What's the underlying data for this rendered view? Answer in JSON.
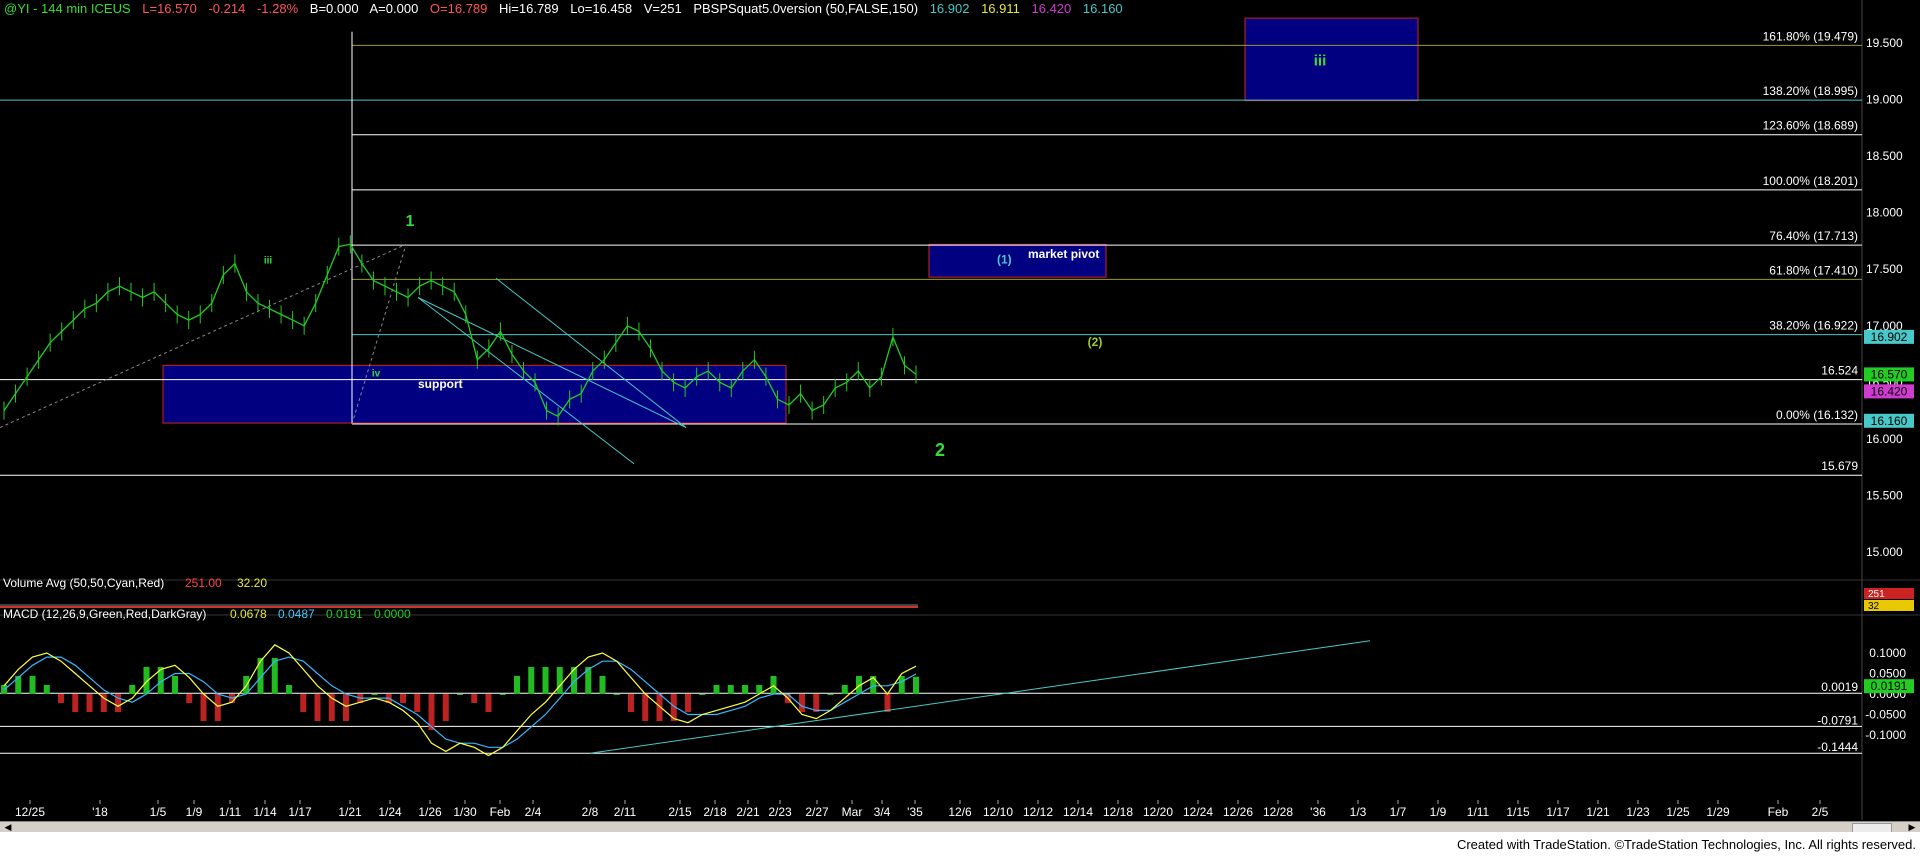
{
  "header": {
    "symbol": "@YI - 144 min  ICEUS",
    "last": "L=16.570",
    "change": "-0.214",
    "pct": "-1.28%",
    "b": "B=0.000",
    "a": "A=0.000",
    "open": "O=16.789",
    "hi": "Hi=16.789",
    "lo": "Lo=16.458",
    "v": "V=251",
    "indicator": "PBSPSquat5.0version (50,FALSE,150)",
    "ind_values": [
      "16.902",
      "16.911",
      "16.420",
      "16.160"
    ]
  },
  "footer": "Created with TradeStation. ©TradeStation Technologies, Inc. All rights reserved.",
  "colors": {
    "price": "#22cc22",
    "fib": "#ffffff",
    "teal": "#48c8c8",
    "olive": "#9a9a3a",
    "box_fill": "#000080",
    "box_border": "#cc2222",
    "wave_label": "#33dd33",
    "macd": "#ffff44",
    "signal": "#3ab6ff"
  },
  "chart_data": [
    {
      "type": "line",
      "name_panel": "price",
      "y_range": [
        14.5,
        19.7
      ],
      "y_ticks": [
        "19.500",
        "19.000",
        "18.500",
        "18.000",
        "17.500",
        "17.000",
        "16.500",
        "16.000",
        "15.500",
        "15.000"
      ],
      "x_labels": [
        "12/25",
        "'18",
        "1/5",
        "1/9",
        "1/11",
        "1/14",
        "1/17",
        "1/21",
        "1/24",
        "1/26",
        "1/30",
        "Feb",
        "2/4",
        "2/8",
        "2/11",
        "2/15",
        "2/18",
        "2/21",
        "2/23",
        "2/27",
        "Mar",
        "3/4",
        "'35",
        "12/6",
        "12/10",
        "12/12",
        "12/14",
        "12/18",
        "12/20",
        "12/24",
        "12/26",
        "12/28",
        "'36",
        "1/3",
        "1/7",
        "1/9",
        "1/11",
        "1/15",
        "1/17",
        "1/21",
        "1/23",
        "1/25",
        "1/29",
        "Feb",
        "2/5"
      ],
      "series": [
        {
          "values": [
            16.25,
            16.4,
            16.55,
            16.7,
            16.85,
            16.95,
            17.05,
            17.15,
            17.2,
            17.3,
            17.35,
            17.3,
            17.25,
            17.3,
            17.2,
            17.1,
            17.05,
            17.1,
            17.2,
            17.45,
            17.55,
            17.3,
            17.2,
            17.15,
            17.1,
            17.05,
            17.0,
            17.2,
            17.45,
            17.7,
            17.72,
            17.55,
            17.4,
            17.35,
            17.3,
            17.25,
            17.35,
            17.4,
            17.35,
            17.3,
            17.1,
            16.7,
            16.8,
            16.95,
            16.75,
            16.6,
            16.5,
            16.25,
            16.2,
            16.35,
            16.4,
            16.6,
            16.7,
            16.85,
            17.0,
            16.95,
            16.8,
            16.6,
            16.5,
            16.45,
            16.55,
            16.6,
            16.5,
            16.45,
            16.6,
            16.7,
            16.55,
            16.35,
            16.3,
            16.4,
            16.25,
            16.3,
            16.45,
            16.5,
            16.6,
            16.45,
            16.55,
            16.9,
            16.65,
            16.57
          ]
        }
      ],
      "fib_levels": [
        {
          "label": "161.80% (19.479)",
          "value": 19.479
        },
        {
          "label": "138.20% (18.995)",
          "value": 18.995
        },
        {
          "label": "123.60% (18.689)",
          "value": 18.689
        },
        {
          "label": "100.00% (18.201)",
          "value": 18.201
        },
        {
          "label": "76.40% (17.713)",
          "value": 17.713
        },
        {
          "label": "61.80% (17.410)",
          "value": 17.41
        },
        {
          "label": "38.20% (16.922)",
          "value": 16.922
        },
        {
          "label": "16.524",
          "value": 16.524
        },
        {
          "label": "0.00% (16.132)",
          "value": 16.132
        },
        {
          "label": "15.679",
          "value": 15.679
        }
      ],
      "price_tags": [
        {
          "text": "16.902",
          "value": 16.902,
          "color": "#48c8c8"
        },
        {
          "text": "16.570",
          "value": 16.57,
          "color": "#22cc22"
        },
        {
          "text": "16.420",
          "value": 16.42,
          "color": "#d03cd0"
        },
        {
          "text": "16.160",
          "value": 16.16,
          "color": "#48c8c8"
        }
      ],
      "boxes": [
        {
          "label": "support",
          "y_top": 16.65,
          "y_bottom": 16.14
        },
        {
          "label": "market pivot",
          "y_top": 17.72,
          "y_bottom": 17.43,
          "sublabel": "(1)"
        },
        {
          "label": "iii",
          "y_top": 19.72,
          "y_bottom": 18.99
        }
      ],
      "wave_labels": [
        "1",
        "iii",
        "iv",
        "2",
        "(2)"
      ]
    },
    {
      "type": "bar",
      "name_panel": "volume",
      "title": "Volume Avg (50,50,Cyan,Red)",
      "values_text": [
        "251.00",
        "32.20"
      ],
      "y_ticks": [
        "251",
        "32"
      ]
    },
    {
      "type": "line",
      "name_panel": "macd",
      "title": "MACD (12,26,9,Green,Red,DarkGray)",
      "values_text": [
        "0.0678",
        "0.0487",
        "0.0191",
        "0.0000"
      ],
      "y_range": [
        -0.16,
        0.15
      ],
      "y_ticks": [
        "0.1000",
        "0.0500",
        "0.0000",
        "-0.0500",
        "-0.1000"
      ],
      "levels": [
        {
          "label": "0.0019",
          "value": 0.0019
        },
        {
          "label": "-0.0791",
          "value": -0.0791
        },
        {
          "label": "-0.1444",
          "value": -0.1444
        }
      ],
      "tags": [
        {
          "text": "0.0191",
          "value": 0.0191,
          "color": "#22cc22"
        }
      ],
      "macd": [
        0.02,
        0.06,
        0.09,
        0.1,
        0.08,
        0.05,
        0.02,
        -0.01,
        -0.03,
        -0.01,
        0.03,
        0.06,
        0.07,
        0.04,
        0.0,
        -0.03,
        -0.02,
        0.02,
        0.08,
        0.12,
        0.1,
        0.06,
        0.02,
        -0.01,
        -0.03,
        -0.02,
        -0.01,
        -0.02,
        -0.04,
        -0.07,
        -0.12,
        -0.14,
        -0.12,
        -0.13,
        -0.15,
        -0.13,
        -0.09,
        -0.05,
        -0.02,
        0.02,
        0.06,
        0.09,
        0.1,
        0.08,
        0.04,
        0.0,
        -0.03,
        -0.06,
        -0.07,
        -0.05,
        -0.04,
        -0.03,
        -0.02,
        0.0,
        0.02,
        -0.01,
        -0.05,
        -0.06,
        -0.04,
        -0.01,
        0.02,
        0.04,
        0.0,
        0.05,
        0.0678
      ],
      "signal": [
        0.01,
        0.04,
        0.07,
        0.09,
        0.09,
        0.07,
        0.04,
        0.01,
        -0.01,
        -0.02,
        0.0,
        0.03,
        0.05,
        0.05,
        0.03,
        0.0,
        -0.01,
        0.0,
        0.04,
        0.08,
        0.09,
        0.08,
        0.05,
        0.02,
        0.0,
        -0.01,
        -0.01,
        -0.01,
        -0.03,
        -0.05,
        -0.08,
        -0.11,
        -0.12,
        -0.12,
        -0.13,
        -0.13,
        -0.11,
        -0.08,
        -0.05,
        -0.01,
        0.03,
        0.06,
        0.08,
        0.08,
        0.06,
        0.03,
        0.0,
        -0.03,
        -0.05,
        -0.05,
        -0.05,
        -0.04,
        -0.03,
        -0.01,
        0.0,
        0.0,
        -0.03,
        -0.04,
        -0.04,
        -0.02,
        0.0,
        0.02,
        0.02,
        0.03,
        0.0487
      ]
    }
  ]
}
